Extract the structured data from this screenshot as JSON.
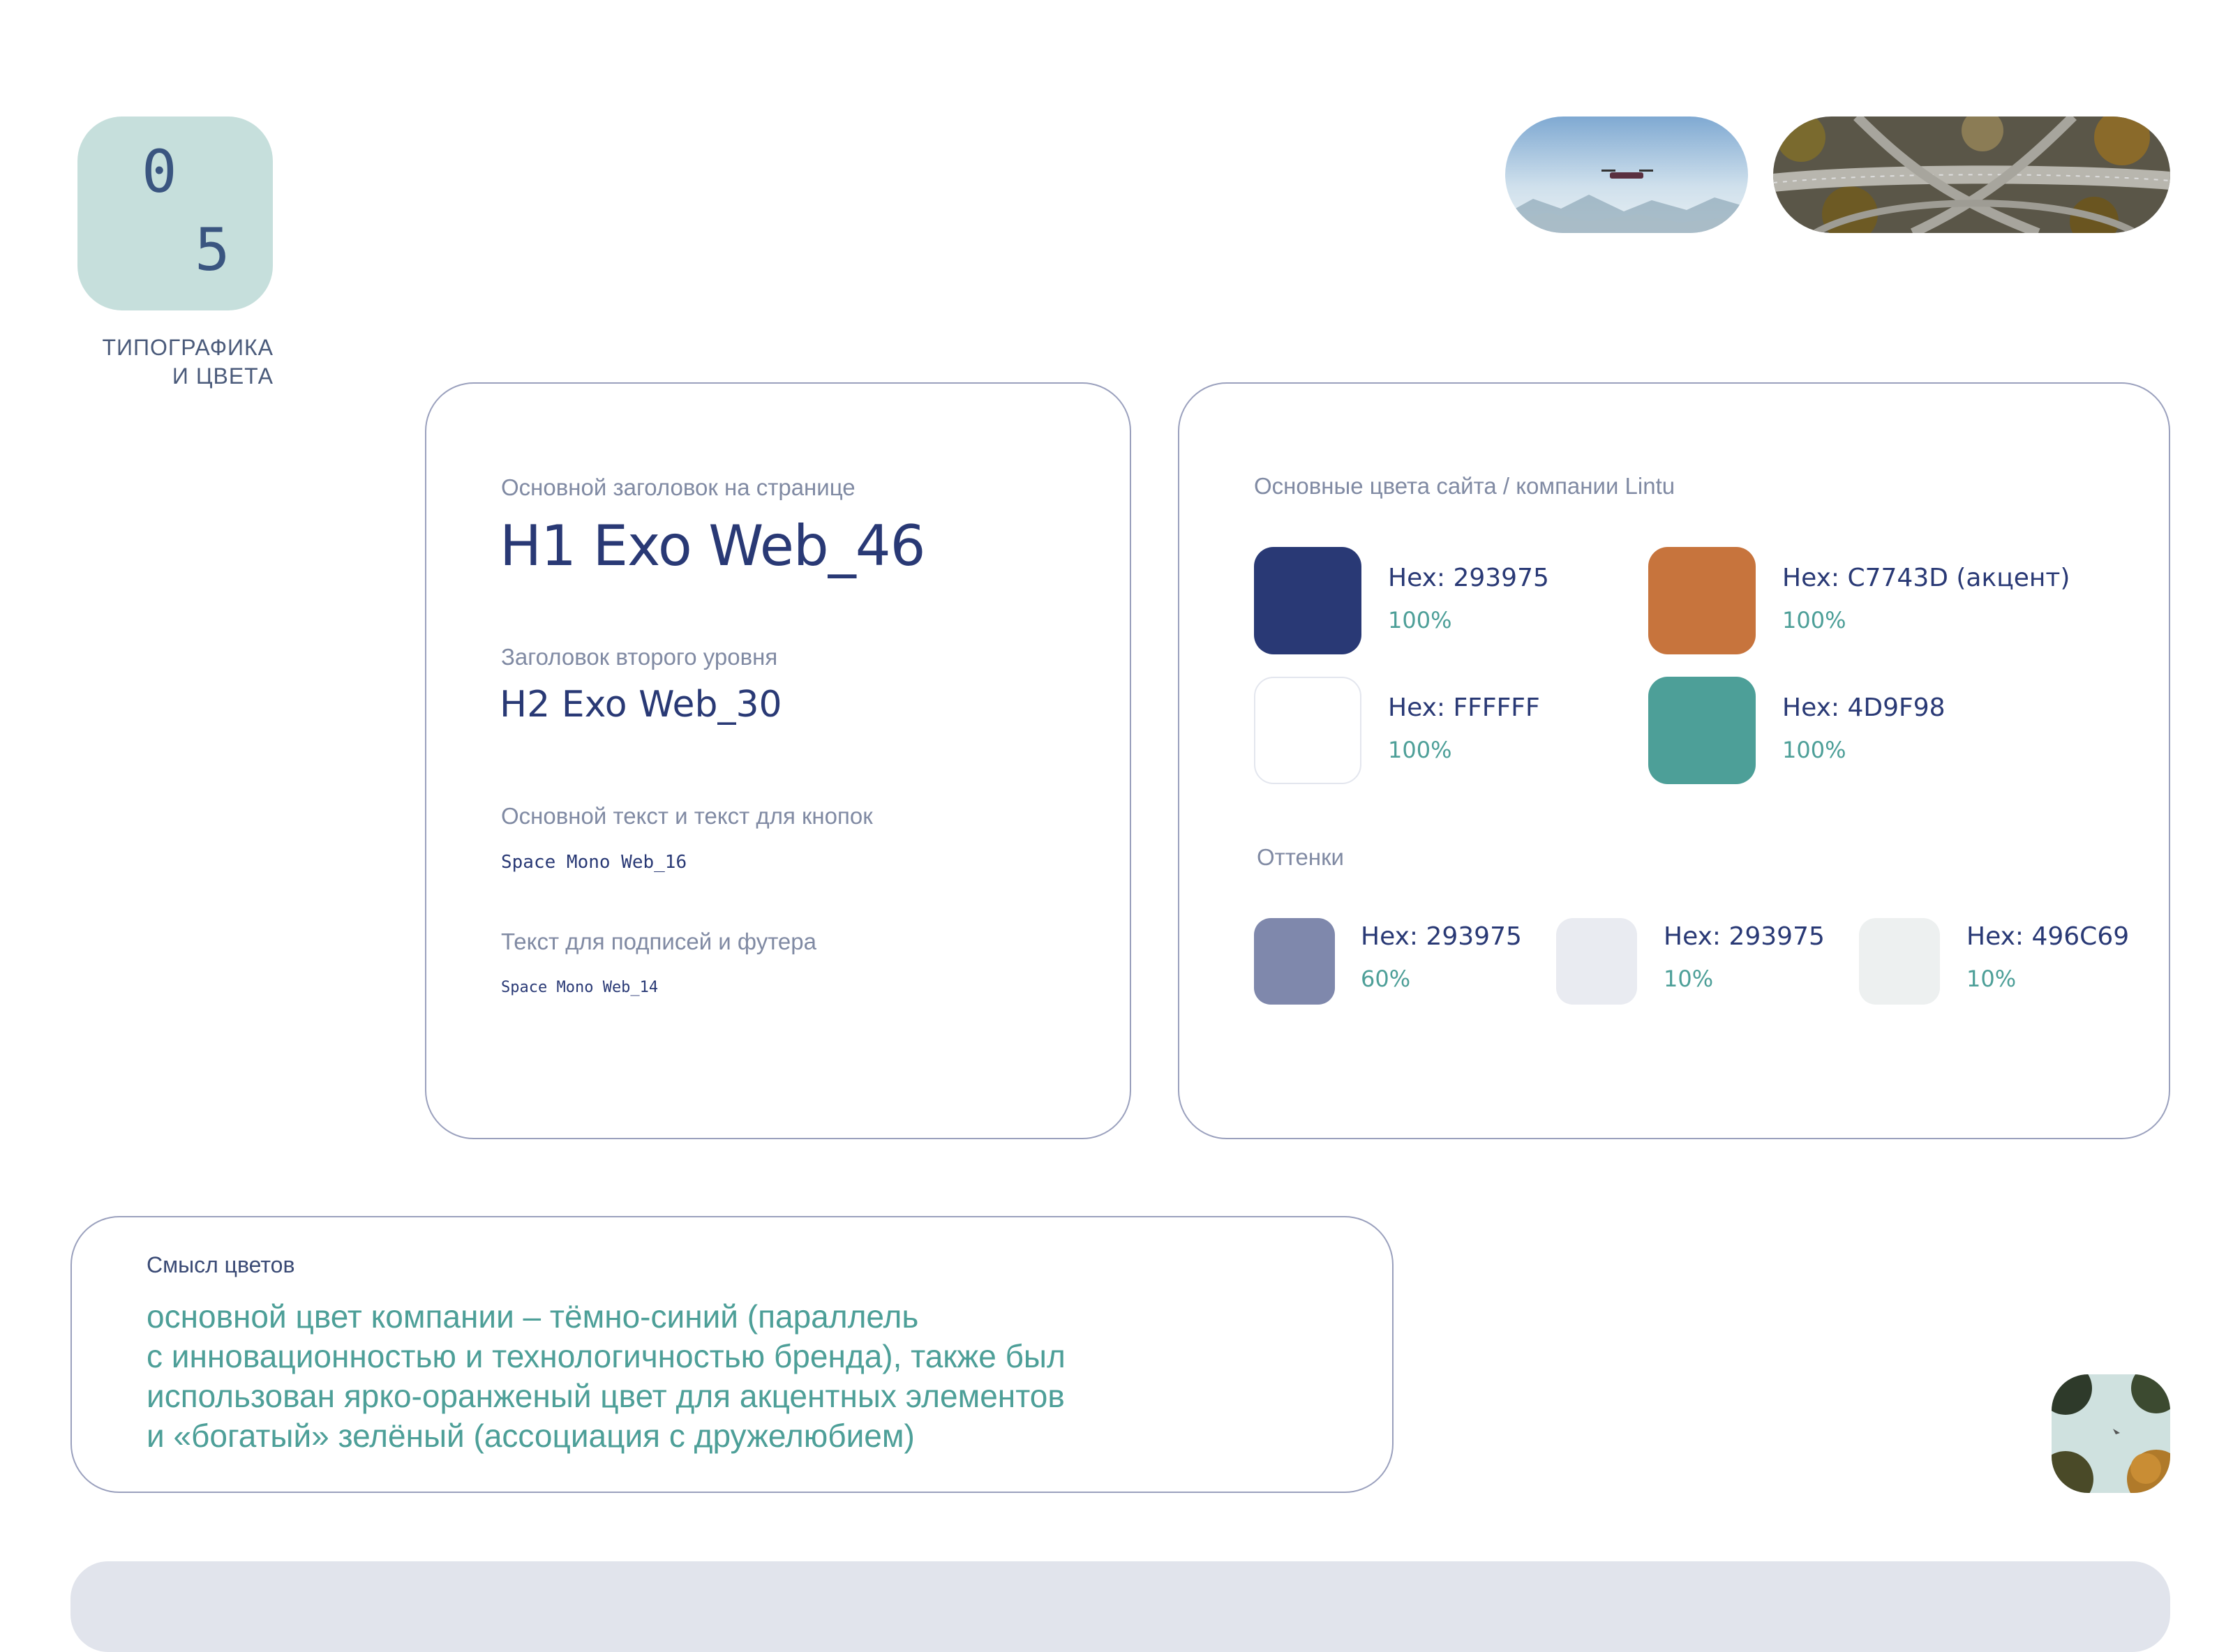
{
  "section": {
    "number_first": "0",
    "number_second": "5",
    "title_line1": "ТИПОГРАФИКА",
    "title_line2": "И ЦВЕТА"
  },
  "typography": {
    "h1_label": "Основной заголовок на странице",
    "h1_sample": "H1 Exo Web_46",
    "h2_label": "Заголовок второго уровня",
    "h2_sample": "H2 Exo Web_30",
    "body_label": "Основной текст и текст для кнопок",
    "body_sample": "Space Mono Web_16",
    "caption_label": "Текст для подписей и футера",
    "caption_sample": "Space Mono Web_14"
  },
  "colors": {
    "title": "Основные цвета сайта / компании Lintu",
    "main": [
      {
        "hex_label": "Hex: 293975",
        "percent": "100%",
        "color": "#293975"
      },
      {
        "hex_label": "Hex: C7743D (акцент)",
        "percent": "100%",
        "color": "#c7743d"
      },
      {
        "hex_label": "Hex: FFFFFF",
        "percent": "100%",
        "color": "#ffffff"
      },
      {
        "hex_label": "Hex: 4D9F98",
        "percent": "100%",
        "color": "#4d9f98"
      }
    ],
    "shades_title": "Оттенки",
    "shades": [
      {
        "hex_label": "Hex: 293975",
        "percent": "60%",
        "color": "#7f88ac"
      },
      {
        "hex_label": "Hex: 293975",
        "percent": "10%",
        "color": "#e9ebf1"
      },
      {
        "hex_label": "Hex: 496C69",
        "percent": "10%",
        "color": "#edf0f0"
      }
    ]
  },
  "meaning": {
    "title": "Смысл цветов",
    "line1": "основной цвет компании – тёмно-синий (параллель",
    "line2": "с инновационностью и технологичностью бренда), также был",
    "line3": "использован ярко-оранженый цвет для акцентных элементов",
    "line4": "и «богатый» зелёный (ассоциация с дружелюбием)"
  }
}
